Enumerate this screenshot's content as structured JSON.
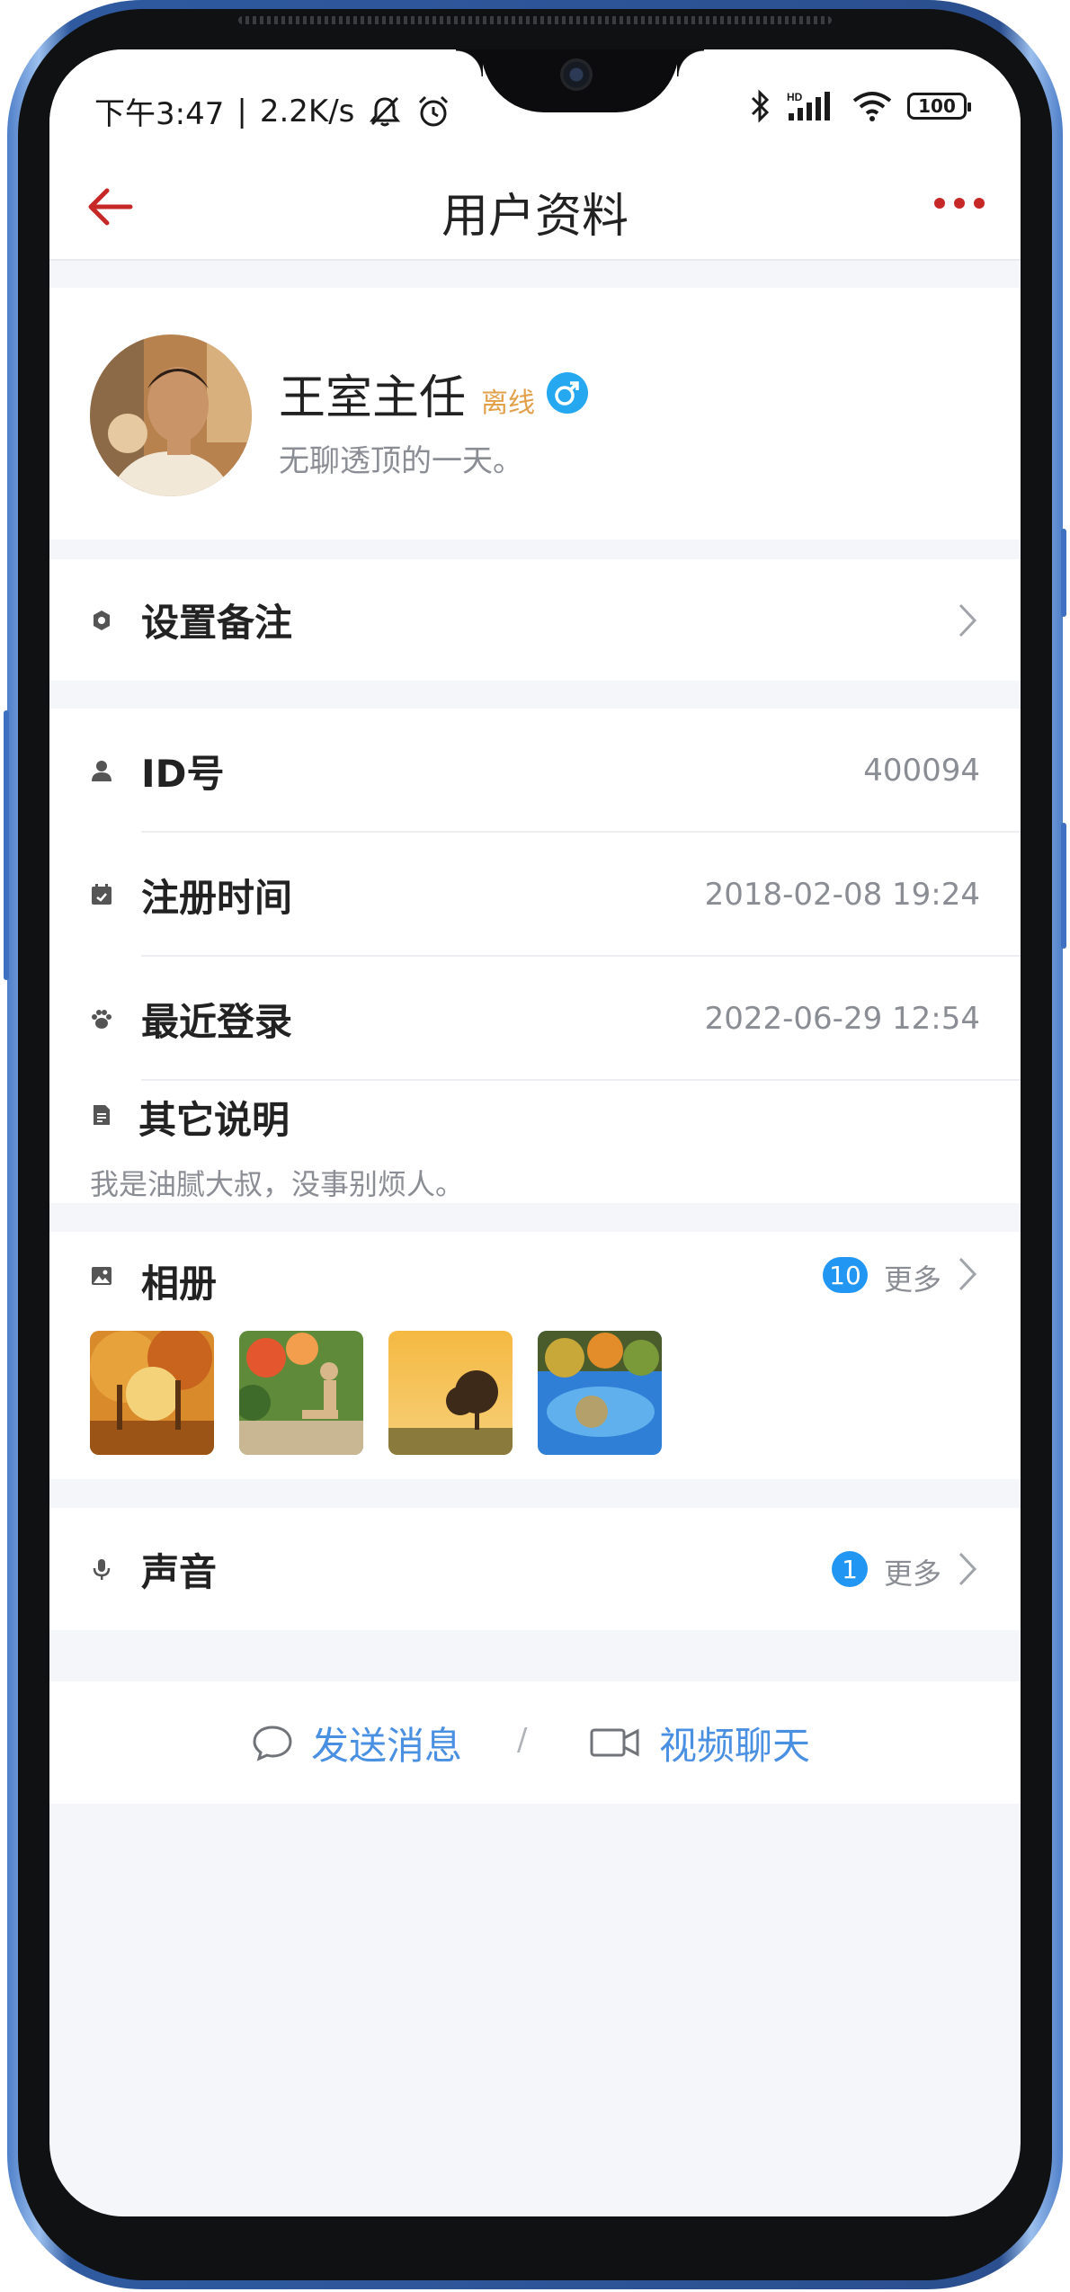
{
  "status_bar": {
    "time": "下午3:47",
    "separator": "|",
    "network_speed": "2.2K/s",
    "battery": "100",
    "icons": [
      "mute-notification-icon",
      "alarm-icon",
      "bluetooth-icon",
      "signal-hd-icon",
      "wifi-icon",
      "battery-icon"
    ]
  },
  "header": {
    "title": "用户资料",
    "back_icon": "arrow-left-icon",
    "more_icon": "three-dots-icon",
    "accent_color": "#c62828"
  },
  "profile": {
    "name": "王室主任",
    "status": "离线",
    "gender_icon": "male-icon",
    "motto": "无聊透顶的一天。"
  },
  "remark": {
    "label": "设置备注",
    "icon": "settings-icon"
  },
  "info": {
    "rows": [
      {
        "label": "ID号",
        "value": "400094",
        "icon": "person-icon"
      },
      {
        "label": "注册时间",
        "value": "2018-02-08 19:24",
        "icon": "calendar-icon"
      },
      {
        "label": "最近登录",
        "value": "2022-06-29 12:54",
        "icon": "paw-icon"
      }
    ],
    "notes_label": "其它说明",
    "notes_icon": "document-icon",
    "notes_text": "我是油腻大叔，没事别烦人。"
  },
  "album": {
    "label": "相册",
    "icon": "image-icon",
    "count": "10",
    "more": "更多",
    "badge_color": "#2196f3"
  },
  "voice": {
    "label": "声音",
    "icon": "microphone-icon",
    "count": "1",
    "more": "更多"
  },
  "actions": {
    "send_message": "发送消息",
    "separator": "/",
    "video_chat": "视频聊天",
    "message_icon": "chat-bubble-icon",
    "video_icon": "video-camera-icon",
    "link_color": "#4a90e2"
  }
}
